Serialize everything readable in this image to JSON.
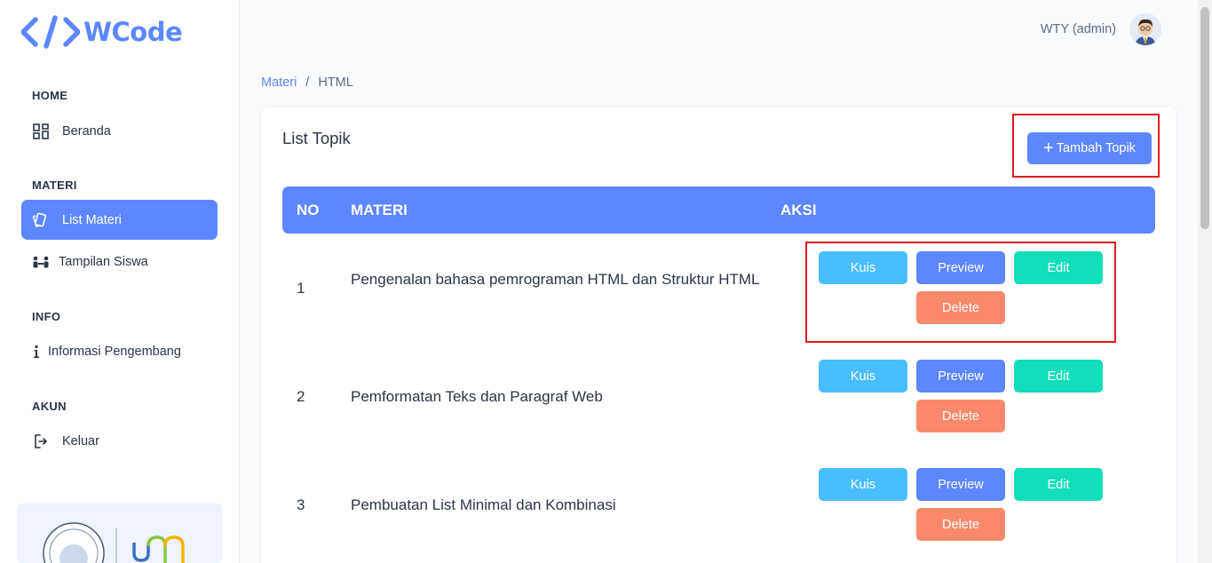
{
  "brand": {
    "name": "WCode",
    "color": "#5d87ff"
  },
  "sidebar": {
    "sections": [
      {
        "title": "HOME"
      },
      {
        "title": "MATERI"
      },
      {
        "title": "INFO"
      },
      {
        "title": "AKUN"
      }
    ],
    "items": [
      {
        "label": "Beranda",
        "icon": "dashboard-icon"
      },
      {
        "label": "List Materi",
        "icon": "cards-icon",
        "active": true
      },
      {
        "label": "Tampilan Siswa",
        "icon": "users-icon"
      },
      {
        "label": "Informasi Pengembang",
        "icon": "info-icon"
      },
      {
        "label": "Keluar",
        "icon": "logout-icon"
      }
    ]
  },
  "header": {
    "user": "WTY (admin)"
  },
  "breadcrumb": {
    "parent": "Materi",
    "separator": "/",
    "current": "HTML"
  },
  "card": {
    "title": "List Topik",
    "add_button": "Tambah Topik",
    "columns": [
      "NO",
      "MATERI",
      "AKSI"
    ],
    "rows": [
      {
        "no": "1",
        "materi": "Pengenalan bahasa pemrograman HTML dan Struktur HTML"
      },
      {
        "no": "2",
        "materi": "Pemformatan Teks dan Paragraf Web"
      },
      {
        "no": "3",
        "materi": "Pembuatan List Minimal dan Kombinasi"
      }
    ],
    "actions": {
      "kuis": "Kuis",
      "preview": "Preview",
      "edit": "Edit",
      "delete": "Delete"
    }
  },
  "colors": {
    "primary": "#5d87ff",
    "kuis": "#49beff",
    "edit": "#13deb9",
    "delete": "#fa896b",
    "highlight": "#e0191e"
  }
}
